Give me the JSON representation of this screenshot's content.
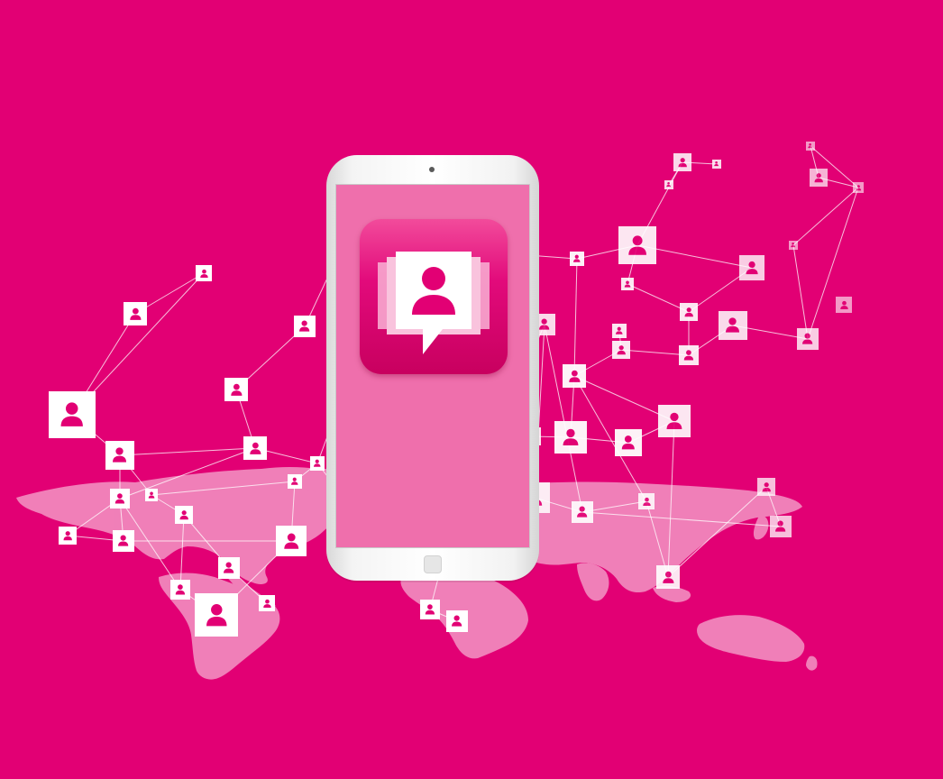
{
  "colors": {
    "background": "#e20074",
    "map": "#f186bc",
    "line": "#ffffff",
    "node": "#ffffff",
    "node_figure": "#e20074",
    "phone_screen": "#ef6fac",
    "phone_body": "#f4f4f4"
  },
  "icons": {
    "app_icon": "chat-bubble-person-icon",
    "network_node": "person-icon",
    "home_button": "square-button-icon"
  }
}
